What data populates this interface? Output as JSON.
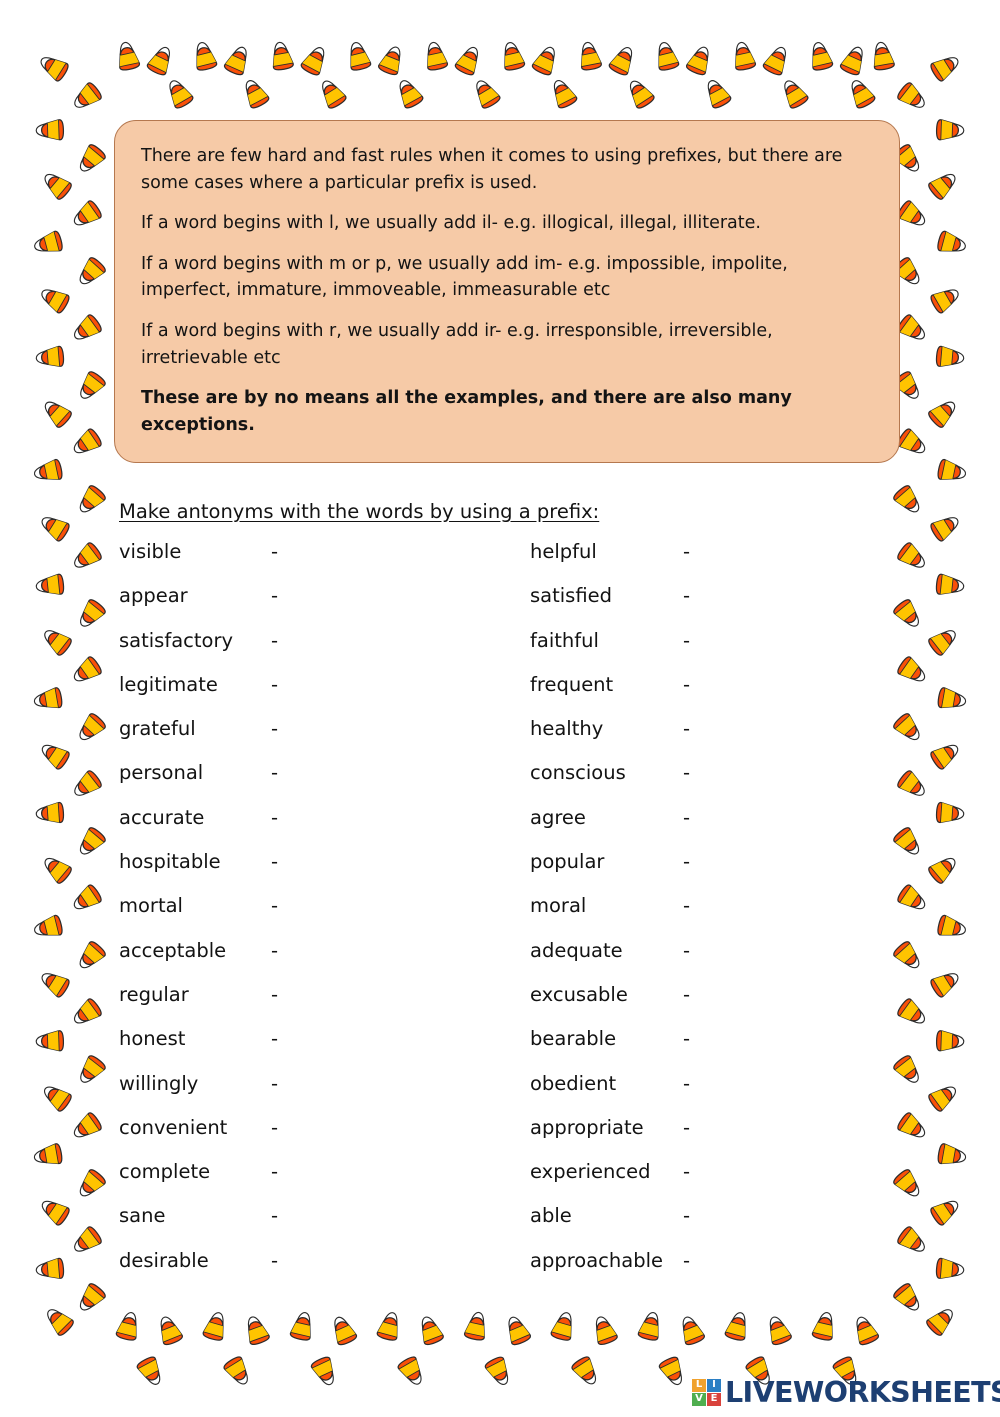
{
  "page": {
    "background_color": "#ffffff",
    "border_theme": "candy-corn"
  },
  "info_box": {
    "background_color": "#f6caa7",
    "border_color": "#b5784f",
    "paragraphs": [
      {
        "text": "There are few hard and fast rules when it comes to using prefixes, but there are some cases where a particular prefix is used.",
        "bold": false
      },
      {
        "text": "If a word begins with l, we usually add il- e.g. illogical, illegal, illiterate.",
        "bold": false
      },
      {
        "text": "If a word begins with m or p, we usually add im- e.g. impossible, impolite, imperfect, immature, immoveable, immeasurable etc",
        "bold": false
      },
      {
        "text": "If a word begins with r, we usually add ir- e.g. irresponsible, irreversible, irretrievable etc",
        "bold": false
      },
      {
        "text": "These are by no means all the examples, and there are also many exceptions.",
        "bold": true
      }
    ]
  },
  "exercise": {
    "instruction": "Make antonyms with the words by using a prefix:",
    "separator": "-",
    "rows": [
      {
        "left": "visible",
        "right": "helpful"
      },
      {
        "left": "appear",
        "right": "satisfied"
      },
      {
        "left": "satisfactory",
        "right": "faithful"
      },
      {
        "left": "legitimate",
        "right": "frequent"
      },
      {
        "left": "grateful",
        "right": "healthy"
      },
      {
        "left": "personal",
        "right": "conscious"
      },
      {
        "left": "accurate",
        "right": "agree"
      },
      {
        "left": "hospitable",
        "right": "popular"
      },
      {
        "left": "mortal",
        "right": "moral"
      },
      {
        "left": "acceptable",
        "right": "adequate"
      },
      {
        "left": "regular",
        "right": "excusable"
      },
      {
        "left": "honest",
        "right": "bearable"
      },
      {
        "left": "willingly",
        "right": "obedient"
      },
      {
        "left": "convenient",
        "right": "appropriate"
      },
      {
        "left": "complete",
        "right": "experienced"
      },
      {
        "left": "sane",
        "right": "able"
      },
      {
        "left": "desirable",
        "right": "approachable"
      }
    ]
  },
  "footer": {
    "logo_mark": [
      "L",
      "I",
      "V",
      "E"
    ],
    "logo_text": "LIVEWORKSHEETS",
    "logo_text_color": "#1d3f72",
    "mark_colors": [
      "#f0a22e",
      "#2b7fc4",
      "#4fae4f",
      "#d9423c"
    ]
  }
}
